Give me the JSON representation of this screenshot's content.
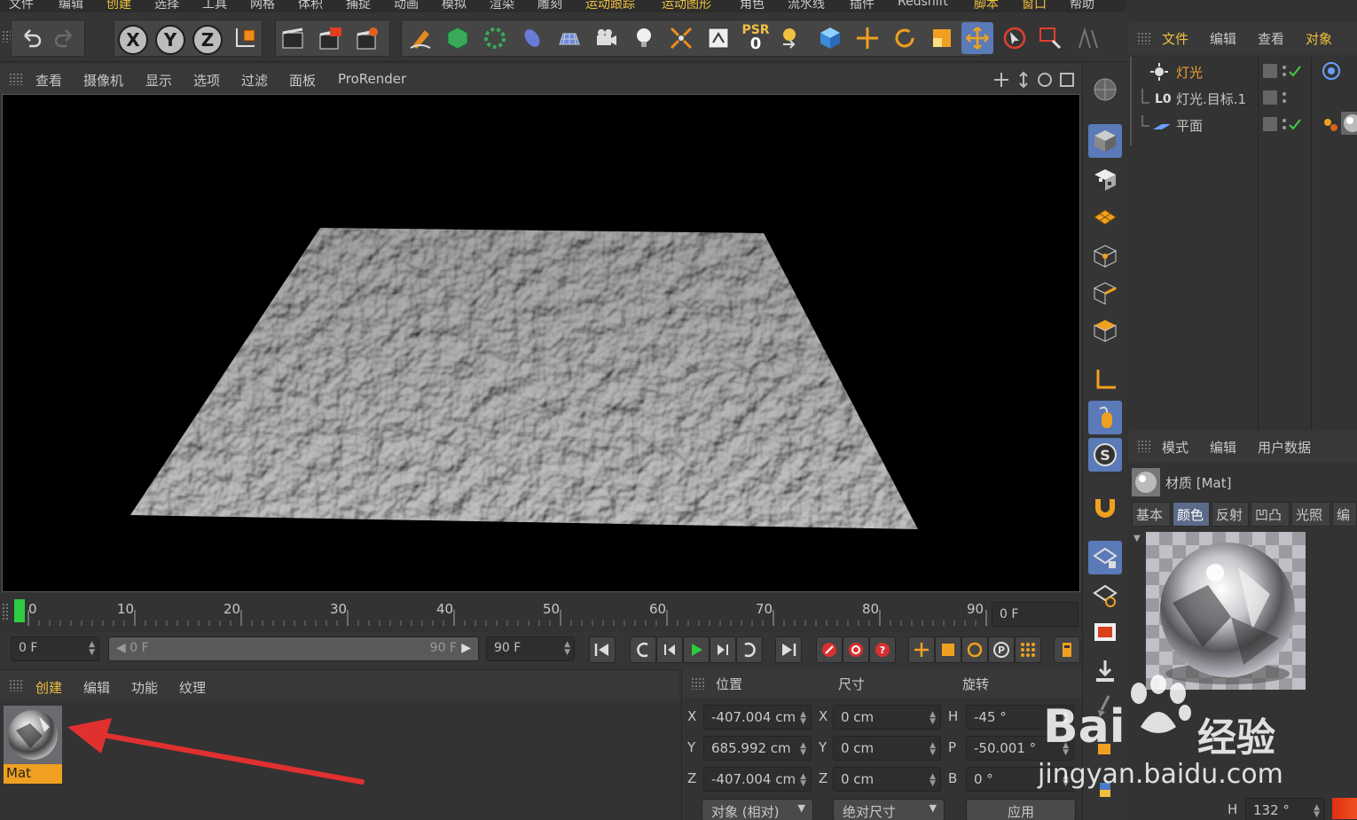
{
  "menu": {
    "items": [
      "文件",
      "编辑",
      "创建",
      "选择",
      "工具",
      "网格",
      "体积",
      "捕捉",
      "动画",
      "模拟",
      "渲染",
      "雕刻",
      "运动跟踪",
      "运动图形",
      "角色",
      "流水线",
      "插件",
      "Redshift",
      "脚本",
      "窗口",
      "帮助"
    ]
  },
  "toolbar": {
    "psr_label": "PSR",
    "psr_value": "0",
    "axis_x": "X",
    "axis_y": "Y",
    "axis_z": "Z"
  },
  "viewport_menu": {
    "items": [
      "查看",
      "摄像机",
      "显示",
      "选项",
      "过滤",
      "面板",
      "ProRender"
    ]
  },
  "timeline": {
    "ticks": [
      "0",
      "10",
      "20",
      "30",
      "40",
      "50",
      "60",
      "70",
      "80",
      "90"
    ],
    "current_frame_field": "0 F",
    "start_field": "0 F",
    "range_start": "0 F",
    "range_end": "90 F",
    "end_field": "90 F"
  },
  "material_manager": {
    "tabs": [
      "创建",
      "编辑",
      "功能",
      "纹理"
    ],
    "materials": [
      {
        "name": "Mat"
      }
    ]
  },
  "coordinates": {
    "headers": {
      "position": "位置",
      "size": "尺寸",
      "rotation": "旋转"
    },
    "rows": [
      {
        "axis": "X",
        "pos": "-407.004 cm",
        "size_axis": "X",
        "size": "0 cm",
        "rot_axis": "H",
        "rot": "-45 °"
      },
      {
        "axis": "Y",
        "pos": "685.992 cm",
        "size_axis": "Y",
        "size": "0 cm",
        "rot_axis": "P",
        "rot": "-50.001 °"
      },
      {
        "axis": "Z",
        "pos": "-407.004 cm",
        "size_axis": "Z",
        "size": "0 cm",
        "rot_axis": "B",
        "rot": "0 °"
      }
    ],
    "mode_dropdown": "对象 (相对)",
    "size_dropdown": "绝对尺寸",
    "apply_button": "应用"
  },
  "object_manager": {
    "tabs": [
      "文件",
      "编辑",
      "查看",
      "对象"
    ],
    "objects": [
      {
        "name": "灯光",
        "color": "#f0a030"
      },
      {
        "name": "灯光.目标.1",
        "color": "#c8c8c8"
      },
      {
        "name": "平面",
        "color": "#c8c8c8"
      }
    ]
  },
  "attribute_manager": {
    "tabs": [
      "模式",
      "编辑",
      "用户数据"
    ],
    "title": "材质 [Mat]",
    "channel_tabs": [
      "基本",
      "颜色",
      "反射",
      "凹凸",
      "光照",
      "编辑"
    ],
    "active_channel": "颜色",
    "h_label": "H",
    "h_value": "132 °"
  },
  "watermark": {
    "brand": "Bai",
    "brand_cn": "经验",
    "url": "jingyan.baidu.com"
  },
  "colors": {
    "accent": "#f0c040",
    "panel": "#333333",
    "viewport_bg": "#000000",
    "highlight_blue": "#5a6a88",
    "timeline_green": "#2ecc40",
    "arrow_red": "#e03030"
  }
}
